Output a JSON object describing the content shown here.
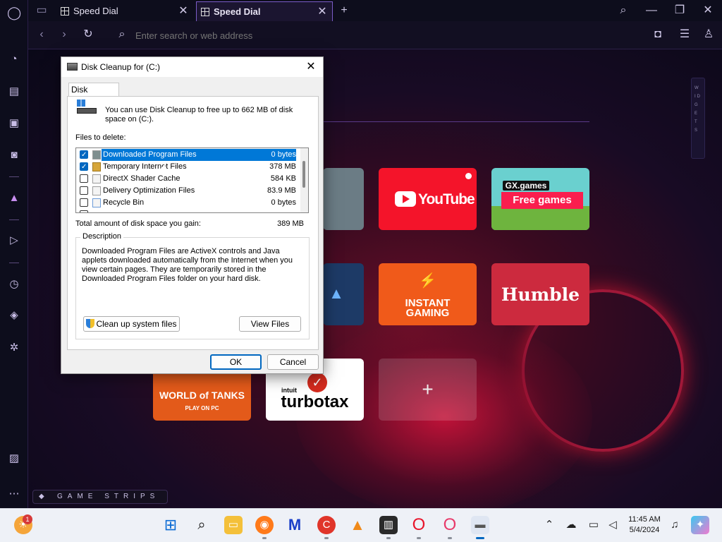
{
  "browser": {
    "tabs": [
      {
        "label": "Speed Dial",
        "active": false
      },
      {
        "label": "Speed Dial",
        "active": true
      }
    ],
    "new_tab_symbol": "+",
    "address_placeholder": "Enter search or web address",
    "widgets_label": "WIDGETS",
    "game_strips_label": "GAME STRIPS"
  },
  "sidebar": {
    "icons": [
      "opera-gx-logo-icon",
      "gx-control-icon",
      "gx-store-icon",
      "twitch-icon",
      "discord-icon",
      "gx-corner-icon",
      "player-icon",
      "history-icon",
      "extensions-icon",
      "settings-icon",
      "wallpaper-icon",
      "more-icon"
    ]
  },
  "speed_dial": {
    "tiles": [
      {
        "name": "youtube",
        "label": "YouTube"
      },
      {
        "name": "gx-games",
        "label": "GX.games",
        "sublabel": "Free games"
      },
      {
        "name": "instant-gaming",
        "label": "INSTANT",
        "sublabel": "GAMING"
      },
      {
        "name": "humble",
        "label": "Humble"
      },
      {
        "name": "world-of-tanks",
        "label": "WORLD of TANKS",
        "sublabel": "PLAY ON PC"
      },
      {
        "name": "turbotax",
        "label": "turbotax",
        "brand": "intuit"
      },
      {
        "name": "add",
        "label": "+"
      }
    ]
  },
  "dialog": {
    "title": "Disk Cleanup for  (C:)",
    "tab": "Disk Cleanup",
    "intro": "You can use Disk Cleanup to free up to 662 MB of disk space on  (C:).",
    "files_label": "Files to delete:",
    "files": [
      {
        "name": "Downloaded Program Files",
        "size": "0 bytes",
        "checked": true,
        "selected": true
      },
      {
        "name": "Temporary Internet Files",
        "size": "378 MB",
        "checked": true,
        "selected": false
      },
      {
        "name": "DirectX Shader Cache",
        "size": "584 KB",
        "checked": false,
        "selected": false
      },
      {
        "name": "Delivery Optimization Files",
        "size": "83.9 MB",
        "checked": false,
        "selected": false
      },
      {
        "name": "Recycle Bin",
        "size": "0 bytes",
        "checked": false,
        "selected": false
      }
    ],
    "total_label": "Total amount of disk space you gain:",
    "total_value": "389 MB",
    "description_label": "Description",
    "description": "Downloaded Program Files are ActiveX controls and Java applets downloaded automatically from the Internet when you view certain pages. They are temporarily stored in the Downloaded Program Files folder on your hard disk.",
    "cleanup_system_label": "Clean up system files",
    "view_files_label": "View Files",
    "ok_label": "OK",
    "cancel_label": "Cancel"
  },
  "taskbar": {
    "weather_badge": "1",
    "time": "11:45 AM",
    "date": "5/4/2024",
    "apps": [
      "start-icon",
      "search-icon",
      "file-explorer-icon",
      "firefox-icon",
      "malwarebytes-icon",
      "ccleaner-icon",
      "vlc-icon",
      "app-icon",
      "opera-icon",
      "opera-gx-icon",
      "disk-cleanup-icon"
    ]
  },
  "colors": {
    "accent": "#7b5cc8",
    "selection": "#0078d7",
    "youtube_red": "#ff0000",
    "humble_red": "#cc2a3e"
  }
}
